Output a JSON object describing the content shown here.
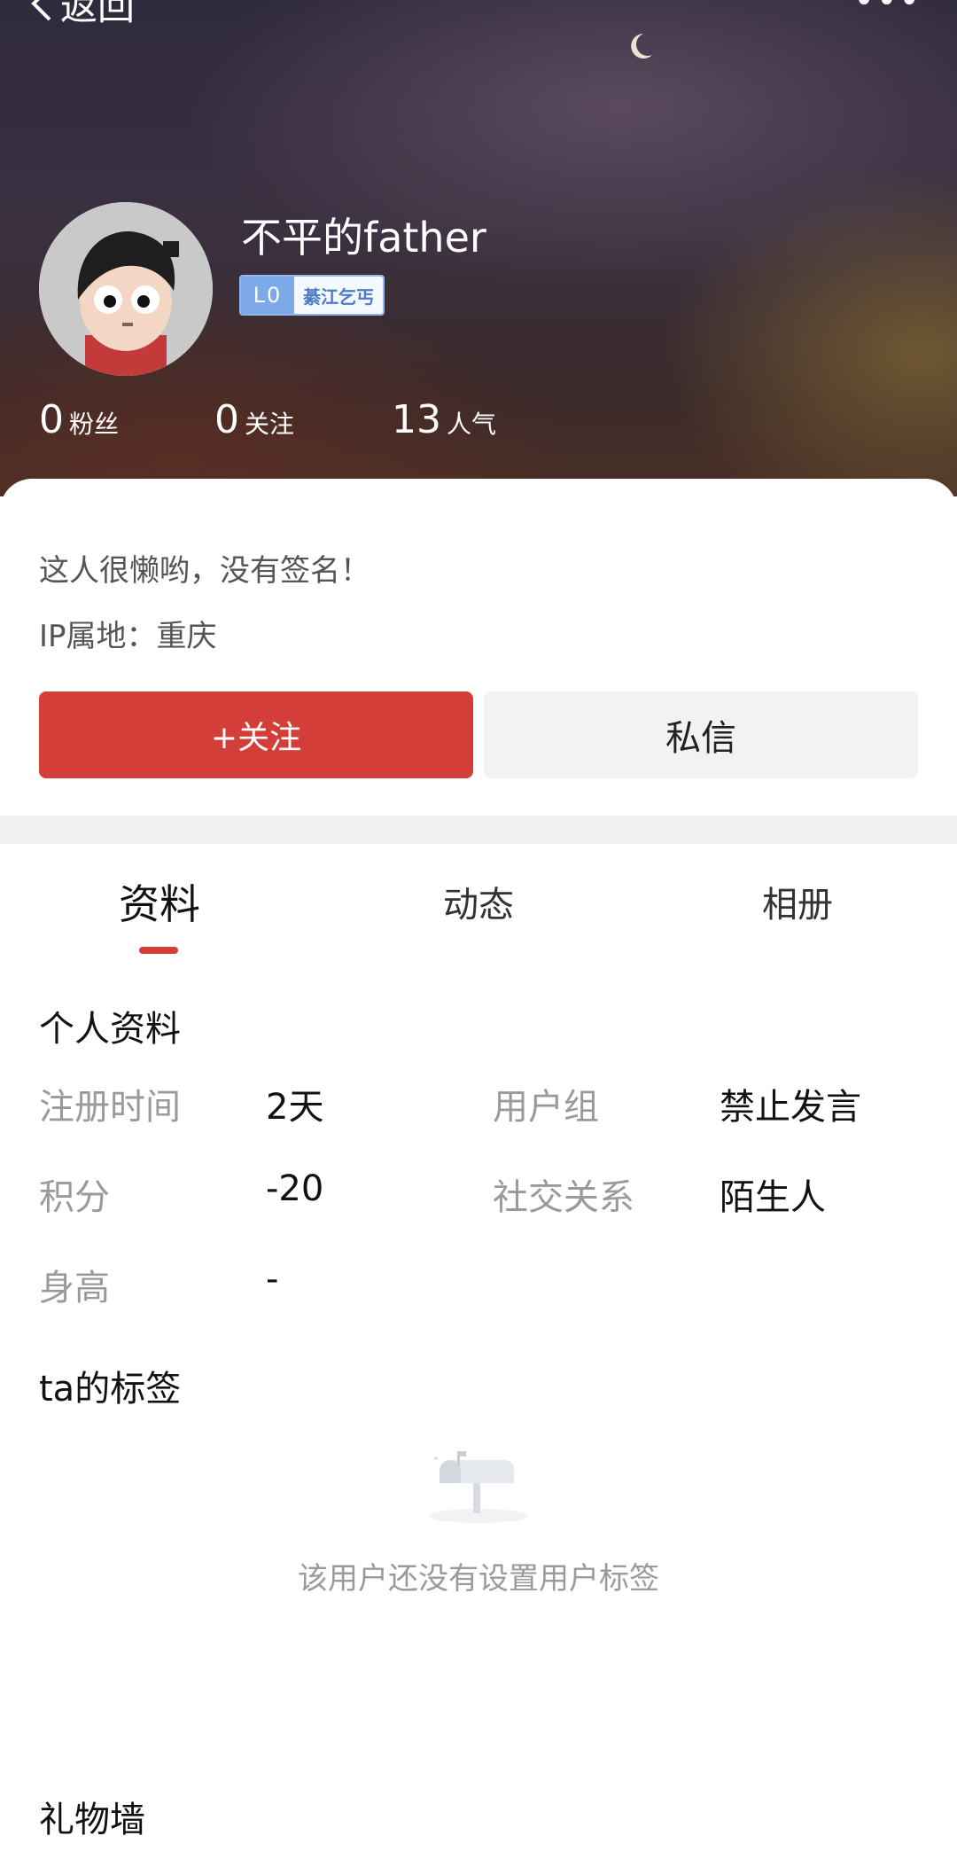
{
  "header": {
    "back_label": "返回",
    "more_label": "•••",
    "username": "不平的father",
    "level": "L0",
    "level_tag": "綦江乞丐",
    "stats": [
      {
        "num": "0",
        "label": "粉丝"
      },
      {
        "num": "0",
        "label": "关注"
      },
      {
        "num": "13",
        "label": "人气"
      }
    ]
  },
  "profile_card": {
    "signature": "这人很懒哟，没有签名！",
    "ip": "IP属地：重庆",
    "follow_button": "+关注",
    "message_button": "私信"
  },
  "tabs": [
    {
      "label": "资料",
      "active": true
    },
    {
      "label": "动态",
      "active": false
    },
    {
      "label": "相册",
      "active": false
    }
  ],
  "personal_info": {
    "title": "个人资料",
    "rows": [
      {
        "label": "注册时间",
        "value": "2天"
      },
      {
        "label": "用户组",
        "value": "禁止发言"
      },
      {
        "label": "积分",
        "value": "-20"
      },
      {
        "label": "社交关系",
        "value": "陌生人"
      },
      {
        "label": "身高",
        "value": "-"
      }
    ]
  },
  "tags_section": {
    "title": "ta的标签",
    "empty_icon": "mailbox-icon",
    "empty_text": "该用户还没有设置用户标签"
  },
  "gift_wall": {
    "title": "礼物墙"
  },
  "colors": {
    "accent": "#d33f38",
    "level_blue": "#7ea9e8"
  }
}
